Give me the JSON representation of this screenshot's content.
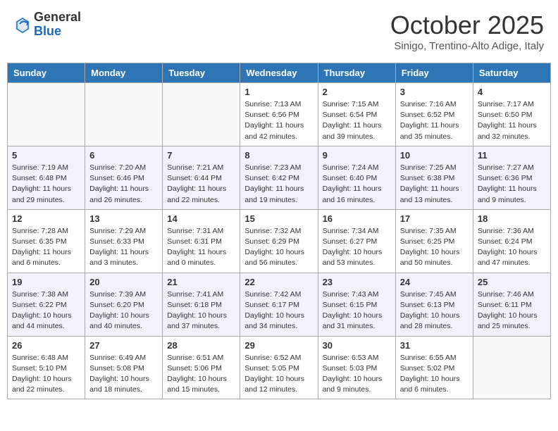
{
  "header": {
    "logo_general": "General",
    "logo_blue": "Blue",
    "month_title": "October 2025",
    "subtitle": "Sinigo, Trentino-Alto Adige, Italy"
  },
  "weekdays": [
    "Sunday",
    "Monday",
    "Tuesday",
    "Wednesday",
    "Thursday",
    "Friday",
    "Saturday"
  ],
  "weeks": [
    [
      {
        "day": "",
        "info": ""
      },
      {
        "day": "",
        "info": ""
      },
      {
        "day": "",
        "info": ""
      },
      {
        "day": "1",
        "info": "Sunrise: 7:13 AM\nSunset: 6:56 PM\nDaylight: 11 hours and 42 minutes."
      },
      {
        "day": "2",
        "info": "Sunrise: 7:15 AM\nSunset: 6:54 PM\nDaylight: 11 hours and 39 minutes."
      },
      {
        "day": "3",
        "info": "Sunrise: 7:16 AM\nSunset: 6:52 PM\nDaylight: 11 hours and 35 minutes."
      },
      {
        "day": "4",
        "info": "Sunrise: 7:17 AM\nSunset: 6:50 PM\nDaylight: 11 hours and 32 minutes."
      }
    ],
    [
      {
        "day": "5",
        "info": "Sunrise: 7:19 AM\nSunset: 6:48 PM\nDaylight: 11 hours and 29 minutes."
      },
      {
        "day": "6",
        "info": "Sunrise: 7:20 AM\nSunset: 6:46 PM\nDaylight: 11 hours and 26 minutes."
      },
      {
        "day": "7",
        "info": "Sunrise: 7:21 AM\nSunset: 6:44 PM\nDaylight: 11 hours and 22 minutes."
      },
      {
        "day": "8",
        "info": "Sunrise: 7:23 AM\nSunset: 6:42 PM\nDaylight: 11 hours and 19 minutes."
      },
      {
        "day": "9",
        "info": "Sunrise: 7:24 AM\nSunset: 6:40 PM\nDaylight: 11 hours and 16 minutes."
      },
      {
        "day": "10",
        "info": "Sunrise: 7:25 AM\nSunset: 6:38 PM\nDaylight: 11 hours and 13 minutes."
      },
      {
        "day": "11",
        "info": "Sunrise: 7:27 AM\nSunset: 6:36 PM\nDaylight: 11 hours and 9 minutes."
      }
    ],
    [
      {
        "day": "12",
        "info": "Sunrise: 7:28 AM\nSunset: 6:35 PM\nDaylight: 11 hours and 6 minutes."
      },
      {
        "day": "13",
        "info": "Sunrise: 7:29 AM\nSunset: 6:33 PM\nDaylight: 11 hours and 3 minutes."
      },
      {
        "day": "14",
        "info": "Sunrise: 7:31 AM\nSunset: 6:31 PM\nDaylight: 11 hours and 0 minutes."
      },
      {
        "day": "15",
        "info": "Sunrise: 7:32 AM\nSunset: 6:29 PM\nDaylight: 10 hours and 56 minutes."
      },
      {
        "day": "16",
        "info": "Sunrise: 7:34 AM\nSunset: 6:27 PM\nDaylight: 10 hours and 53 minutes."
      },
      {
        "day": "17",
        "info": "Sunrise: 7:35 AM\nSunset: 6:25 PM\nDaylight: 10 hours and 50 minutes."
      },
      {
        "day": "18",
        "info": "Sunrise: 7:36 AM\nSunset: 6:24 PM\nDaylight: 10 hours and 47 minutes."
      }
    ],
    [
      {
        "day": "19",
        "info": "Sunrise: 7:38 AM\nSunset: 6:22 PM\nDaylight: 10 hours and 44 minutes."
      },
      {
        "day": "20",
        "info": "Sunrise: 7:39 AM\nSunset: 6:20 PM\nDaylight: 10 hours and 40 minutes."
      },
      {
        "day": "21",
        "info": "Sunrise: 7:41 AM\nSunset: 6:18 PM\nDaylight: 10 hours and 37 minutes."
      },
      {
        "day": "22",
        "info": "Sunrise: 7:42 AM\nSunset: 6:17 PM\nDaylight: 10 hours and 34 minutes."
      },
      {
        "day": "23",
        "info": "Sunrise: 7:43 AM\nSunset: 6:15 PM\nDaylight: 10 hours and 31 minutes."
      },
      {
        "day": "24",
        "info": "Sunrise: 7:45 AM\nSunset: 6:13 PM\nDaylight: 10 hours and 28 minutes."
      },
      {
        "day": "25",
        "info": "Sunrise: 7:46 AM\nSunset: 6:11 PM\nDaylight: 10 hours and 25 minutes."
      }
    ],
    [
      {
        "day": "26",
        "info": "Sunrise: 6:48 AM\nSunset: 5:10 PM\nDaylight: 10 hours and 22 minutes."
      },
      {
        "day": "27",
        "info": "Sunrise: 6:49 AM\nSunset: 5:08 PM\nDaylight: 10 hours and 18 minutes."
      },
      {
        "day": "28",
        "info": "Sunrise: 6:51 AM\nSunset: 5:06 PM\nDaylight: 10 hours and 15 minutes."
      },
      {
        "day": "29",
        "info": "Sunrise: 6:52 AM\nSunset: 5:05 PM\nDaylight: 10 hours and 12 minutes."
      },
      {
        "day": "30",
        "info": "Sunrise: 6:53 AM\nSunset: 5:03 PM\nDaylight: 10 hours and 9 minutes."
      },
      {
        "day": "31",
        "info": "Sunrise: 6:55 AM\nSunset: 5:02 PM\nDaylight: 10 hours and 6 minutes."
      },
      {
        "day": "",
        "info": ""
      }
    ]
  ]
}
